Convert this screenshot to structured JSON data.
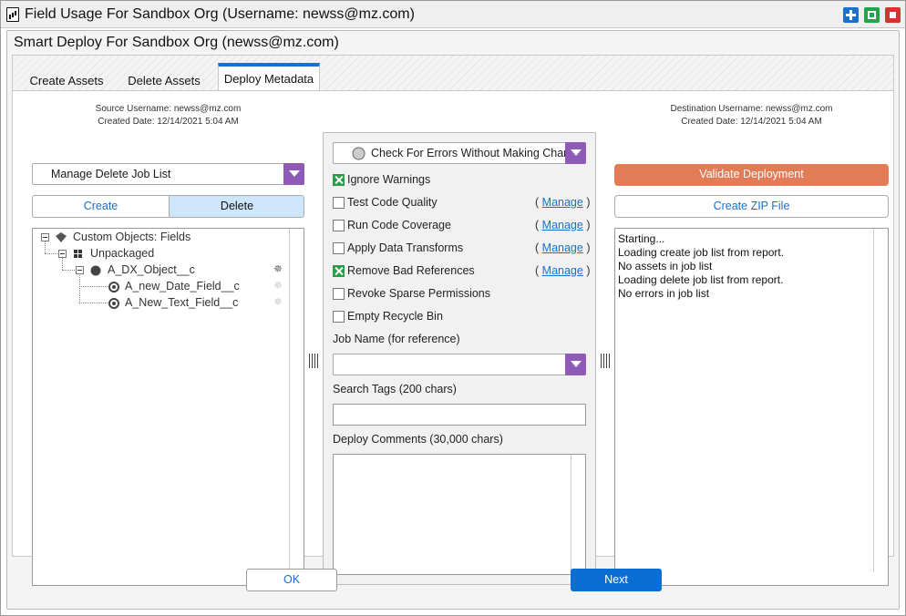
{
  "window": {
    "title": "Field Usage For Sandbox Org (Username: newss@mz.com)"
  },
  "dialog": {
    "title": "Smart Deploy For Sandbox Org (newss@mz.com)"
  },
  "tabs": [
    {
      "label": "Create Assets",
      "active": false
    },
    {
      "label": "Delete Assets",
      "active": false
    },
    {
      "label": "Deploy Metadata",
      "active": true
    }
  ],
  "source": {
    "username_line": "Source Username: newss@mz.com",
    "created_line": "Created Date: 12/14/2021 5:04 AM",
    "job_list_select": "Manage Delete Job List",
    "toggle": {
      "create_label": "Create",
      "delete_label": "Delete",
      "selected": "Delete"
    }
  },
  "tree": {
    "root": "Custom Objects: Fields",
    "package": "Unpackaged",
    "object": "A_DX_Object__c",
    "fields": [
      "A_new_Date_Field__c",
      "A_New_Text_Field__c"
    ]
  },
  "options": {
    "mode_select": "Check For Errors Without Making Changes",
    "checkboxes": [
      {
        "label": "Ignore Warnings",
        "checked": true,
        "manage": false
      },
      {
        "label": "Test Code Quality",
        "checked": false,
        "manage": true
      },
      {
        "label": "Run Code Coverage",
        "checked": false,
        "manage": true
      },
      {
        "label": "Apply Data Transforms",
        "checked": false,
        "manage": true
      },
      {
        "label": "Remove Bad References",
        "checked": true,
        "manage": true
      },
      {
        "label": "Revoke Sparse Permissions",
        "checked": false,
        "manage": false
      },
      {
        "label": "Empty Recycle Bin",
        "checked": false,
        "manage": false
      }
    ],
    "manage_label": "Manage",
    "manage_open": "(",
    "manage_close": ")",
    "job_name_label": "Job Name (for reference)",
    "job_name_value": "",
    "search_tags_label": "Search Tags (200 chars)",
    "search_tags_value": "",
    "deploy_comments_label": "Deploy Comments (30,000 chars)",
    "deploy_comments_value": ""
  },
  "destination": {
    "username_line": "Destination Username: newss@mz.com",
    "created_line": "Created Date: 12/14/2021 5:04 AM",
    "validate_label": "Validate Deployment",
    "zip_label": "Create ZIP File",
    "log": [
      "Starting...",
      "Loading create job list from report.",
      "No assets in job list",
      "Loading delete job list from report.",
      "No errors in job list"
    ]
  },
  "footer": {
    "ok_label": "OK",
    "next_label": "Next"
  },
  "colors": {
    "accent": "#1b70c9",
    "select_arrow": "#8d5bb5",
    "validate": "#e37b57",
    "checkbox_checked": "#2a9d4a",
    "next": "#0b6ed3"
  }
}
